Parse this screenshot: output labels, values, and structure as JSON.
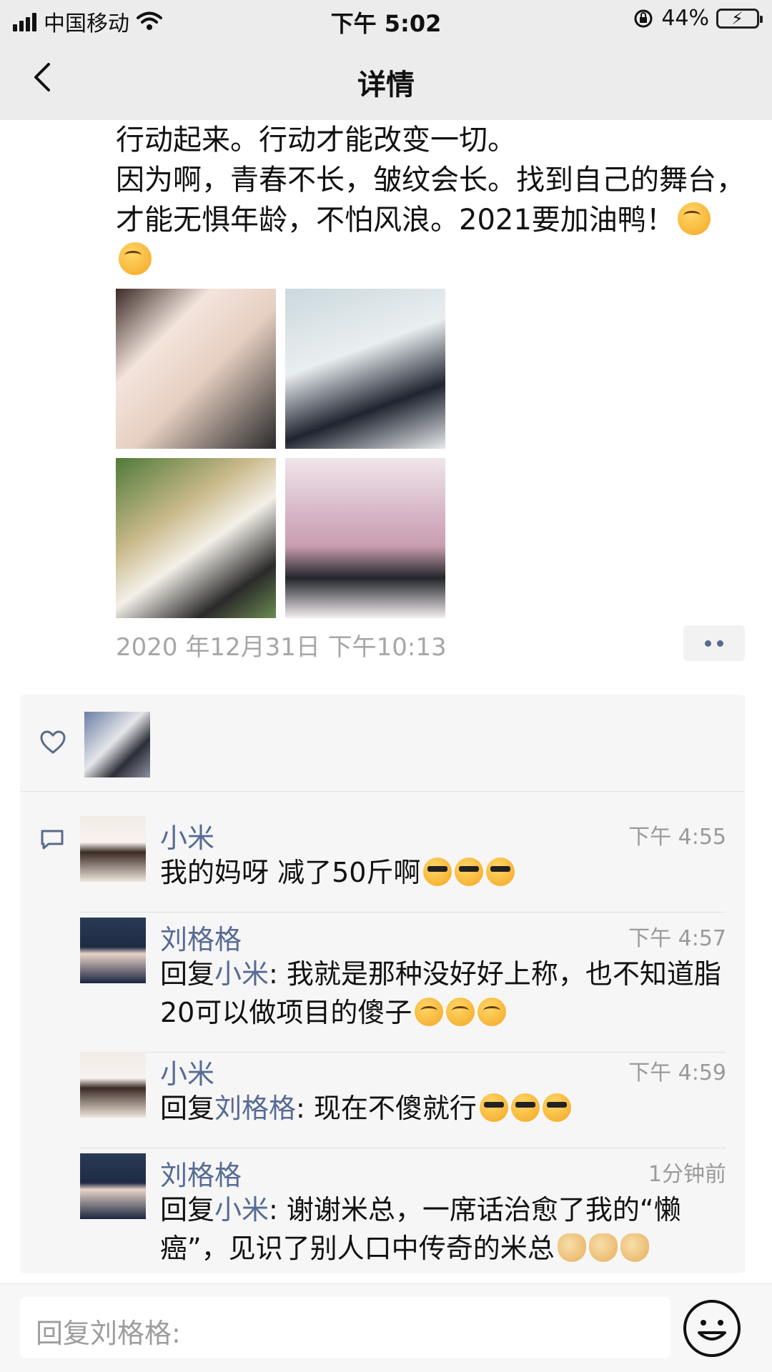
{
  "status_bar": {
    "carrier": "中国移动",
    "time": "下午 5:02",
    "battery": "44%",
    "battery_level": 0.44,
    "icons": [
      "signal-icon",
      "wifi-icon",
      "rotation-lock-icon",
      "battery-icon"
    ]
  },
  "nav": {
    "title": "详情",
    "back_icon": "back-chevron-icon"
  },
  "post": {
    "text_line1": "行动起来。行动才能改变一切。",
    "text_line2": "因为啊，青春不长，皱纹会长。找到自己的舞台，才能无惧年龄，不怕风浪。2021要加油鸭！",
    "emojis": [
      "smirk-emoji",
      "smirk-emoji"
    ],
    "photo_count": 4,
    "timestamp": "2020 年12月31日 下午10:13",
    "more_icon": "more-dots-icon"
  },
  "interactions": {
    "like_icon": "heart-icon",
    "comment_icon": "comment-icon",
    "comments": [
      {
        "name": "小米",
        "time": "下午 4:55",
        "reply_prefix": "",
        "reply_to": "",
        "body": "我的妈呀 减了50斤啊",
        "emojis": [
          "cool-666-emoji",
          "cool-666-emoji",
          "cool-666-emoji"
        ]
      },
      {
        "name": "刘格格",
        "time": "下午 4:57",
        "reply_prefix": "回复",
        "reply_to": "小米",
        "body": ": 我就是那种没好好上称，也不知道脂20可以做项目的傻子",
        "emojis": [
          "bug-eyes-emoji",
          "bug-eyes-emoji",
          "bug-eyes-emoji"
        ]
      },
      {
        "name": "小米",
        "time": "下午 4:59",
        "reply_prefix": "回复",
        "reply_to": "刘格格",
        "body": ": 现在不傻就行",
        "emojis": [
          "sunglasses-emoji",
          "sunglasses-emoji",
          "sunglasses-emoji"
        ]
      },
      {
        "name": "刘格格",
        "time": "1分钟前",
        "reply_prefix": "回复",
        "reply_to": "小米",
        "body": ": 谢谢米总，一席话治愈了我的“懒癌”，见识了别人口中传奇的米总",
        "emojis": [
          "clap-emoji",
          "clap-emoji",
          "clap-emoji"
        ]
      }
    ]
  },
  "reply_bar": {
    "placeholder": "回复刘格格:",
    "emoji_icon": "smile-face-icon"
  }
}
